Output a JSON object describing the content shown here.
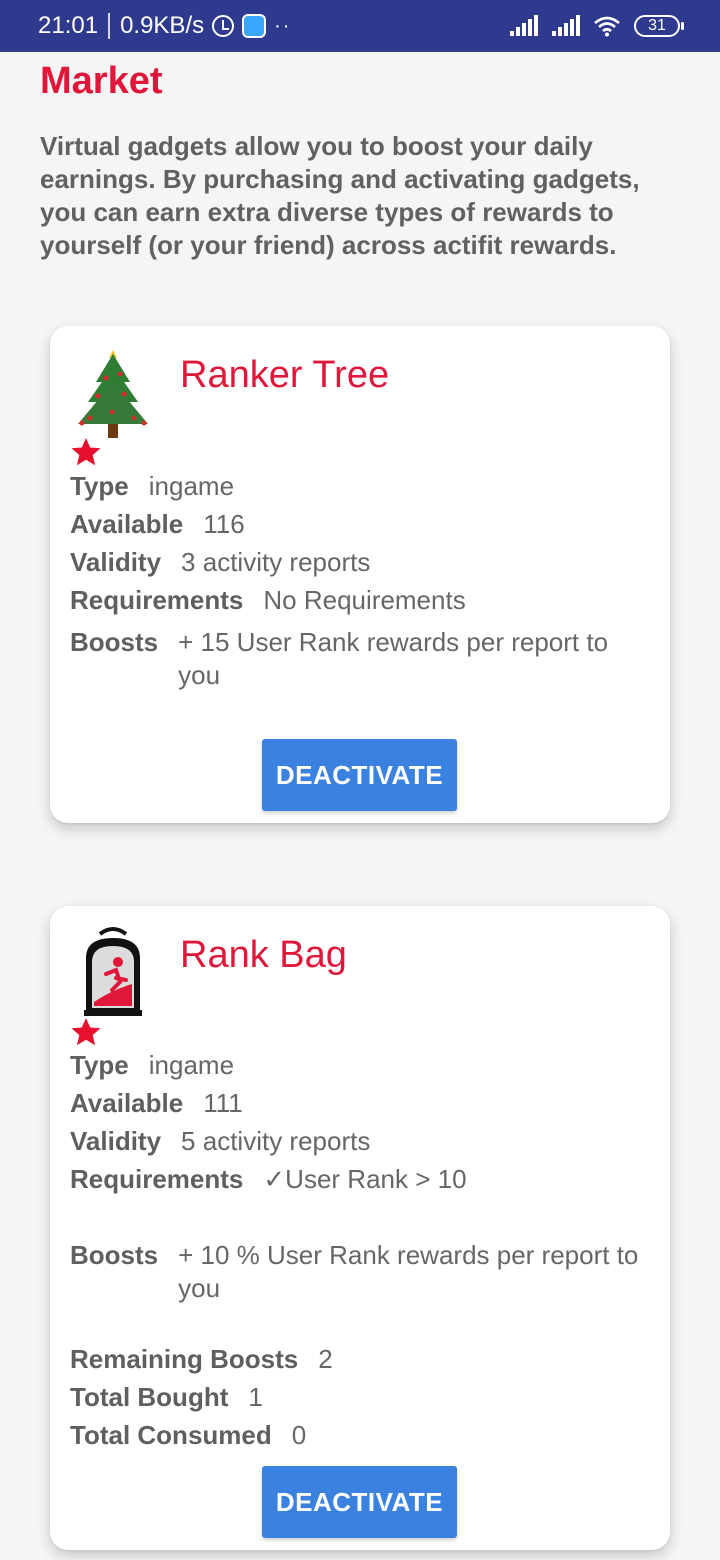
{
  "status_bar": {
    "time": "21:01",
    "speed": "0.9KB/s",
    "battery": "31",
    "icons": [
      "alarm-icon",
      "app-icon",
      "more-dots-icon",
      "signal-icon",
      "signal-icon",
      "wifi-icon",
      "battery-icon"
    ]
  },
  "page": {
    "title": "Market",
    "intro": "Virtual gadgets allow you to boost your daily earnings. By purchasing and activating gadgets, you can earn extra diverse types of rewards to yourself (or your friend) across actifit rewards."
  },
  "gadgets": [
    {
      "name": "Ranker Tree",
      "icon": "christmas-tree-icon",
      "type_label": "Type",
      "type": "ingame",
      "available_label": "Available",
      "available": "116",
      "validity_label": "Validity",
      "validity": "3 activity reports",
      "requirements_label": "Requirements",
      "requirements": "No Requirements",
      "boosts_label": "Boosts",
      "boosts": "+ 15 User Rank rewards per report to you",
      "button": "DEACTIVATE"
    },
    {
      "name": "Rank Bag",
      "icon": "backpack-icon",
      "type_label": "Type",
      "type": "ingame",
      "available_label": "Available",
      "available": "111",
      "validity_label": "Validity",
      "validity": "5 activity reports",
      "requirements_label": "Requirements",
      "requirements": "✓User Rank > 10",
      "boosts_label": "Boosts",
      "boosts": "+ 10 % User Rank rewards per report to you",
      "remaining_label": "Remaining Boosts",
      "remaining": "2",
      "bought_label": "Total Bought",
      "bought": "1",
      "consumed_label": "Total Consumed",
      "consumed": "0",
      "button": "DEACTIVATE"
    }
  ],
  "colors": {
    "status_bar": "#2f3a8f",
    "accent_red": "#e0173a",
    "button_blue": "#3b82e0",
    "requirement_ok": "#0b7a12"
  }
}
